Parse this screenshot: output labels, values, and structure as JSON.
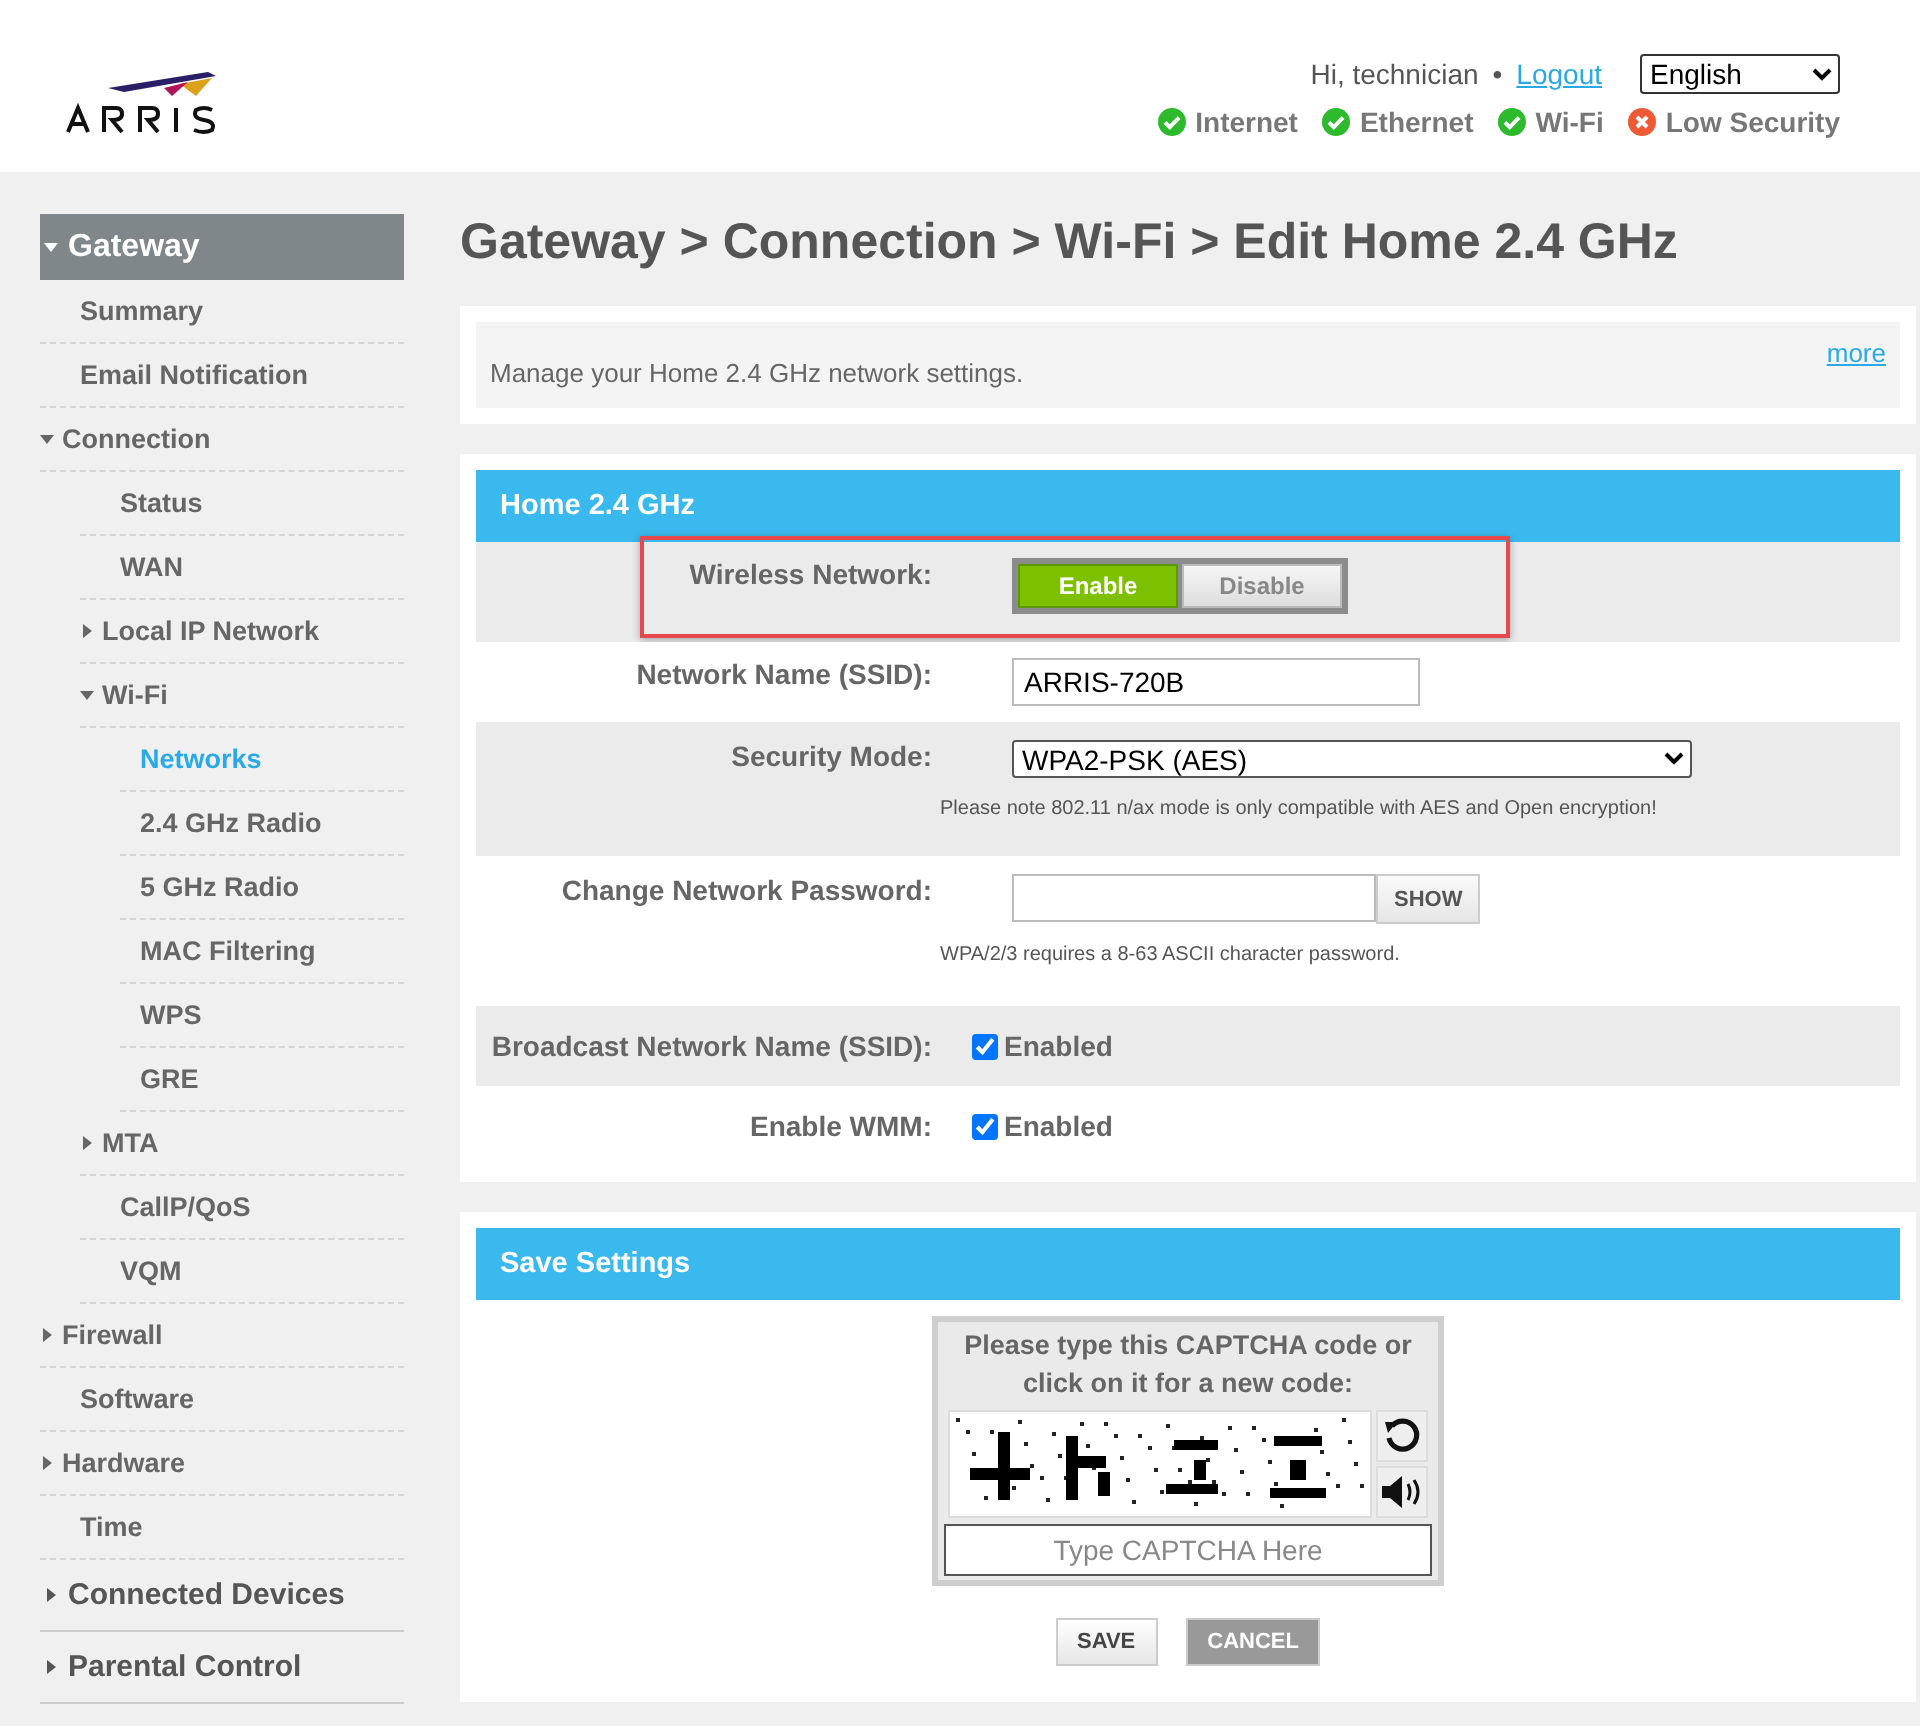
{
  "header": {
    "greeting": "Hi, technician",
    "separator": "•",
    "logout": "Logout",
    "language": "English",
    "status": [
      {
        "label": "Internet",
        "ok": true
      },
      {
        "label": "Ethernet",
        "ok": true
      },
      {
        "label": "Wi-Fi",
        "ok": true
      },
      {
        "label": "Low Security",
        "ok": false
      }
    ]
  },
  "sidebar": {
    "items": [
      {
        "label": "Gateway",
        "selected": false,
        "expanded": true,
        "children": [
          {
            "label": "Summary",
            "selected": false
          },
          {
            "label": "Email Notification",
            "selected": false
          },
          {
            "label": "Connection",
            "selected": false,
            "expanded": true,
            "children": [
              {
                "label": "Status",
                "selected": false
              },
              {
                "label": "WAN",
                "selected": false
              },
              {
                "label": "Local IP Network",
                "selected": false,
                "expanded": false
              },
              {
                "label": "Wi-Fi",
                "selected": false,
                "expanded": true,
                "children": [
                  {
                    "label": "Networks",
                    "selected": true
                  },
                  {
                    "label": "2.4 GHz Radio",
                    "selected": false
                  },
                  {
                    "label": "5 GHz Radio",
                    "selected": false
                  },
                  {
                    "label": "MAC Filtering",
                    "selected": false
                  },
                  {
                    "label": "WPS",
                    "selected": false
                  },
                  {
                    "label": "GRE",
                    "selected": false
                  }
                ]
              },
              {
                "label": "MTA",
                "selected": false,
                "expanded": false
              },
              {
                "label": "CallP/QoS",
                "selected": false
              },
              {
                "label": "VQM",
                "selected": false
              }
            ]
          },
          {
            "label": "Firewall",
            "selected": false,
            "expanded": false
          },
          {
            "label": "Software",
            "selected": false
          },
          {
            "label": "Hardware",
            "selected": false,
            "expanded": false
          },
          {
            "label": "Time",
            "selected": false
          }
        ]
      },
      {
        "label": "Connected Devices",
        "selected": false,
        "expanded": false
      },
      {
        "label": "Parental Control",
        "selected": false,
        "expanded": false
      }
    ]
  },
  "page_title": "Gateway > Connection > Wi-Fi > Edit Home 2.4 GHz",
  "intro": {
    "text": "Manage your Home 2.4 GHz network settings.",
    "link": "more"
  },
  "network_panel": {
    "title": "Home 2.4 GHz",
    "rows": [
      {
        "kind": "toggle",
        "label": "Wireless Network:",
        "highlighted": true,
        "options": [
          {
            "label": "Enable",
            "selected": true
          },
          {
            "label": "Disable",
            "selected": false
          }
        ]
      },
      {
        "kind": "text",
        "label": "Network Name (SSID):",
        "value": "ARRIS-720B"
      },
      {
        "kind": "select",
        "label": "Security Mode:",
        "value": "WPA2-PSK (AES)",
        "note": "Please note 802.11 n/ax mode is only compatible with AES and Open encryption!"
      },
      {
        "kind": "password",
        "label": "Change Network Password:",
        "button": "SHOW",
        "note": "WPA/2/3 requires a 8-63 ASCII character password."
      },
      {
        "kind": "checkbox",
        "label": "Broadcast Network Name (SSID):",
        "checked": true,
        "option": "Enabled"
      },
      {
        "kind": "checkbox",
        "label": "Enable WMM:",
        "checked": true,
        "option": "Enabled"
      }
    ]
  },
  "save_panel": {
    "title": "Save Settings",
    "captcha": {
      "prompt": "Please type this CAPTCHA code or click on it for a new code:",
      "placeholder": "Type CAPTCHA Here"
    },
    "buttons": [
      {
        "label": "SAVE",
        "kind": "primary"
      },
      {
        "label": "CANCEL",
        "kind": "secondary"
      }
    ]
  }
}
